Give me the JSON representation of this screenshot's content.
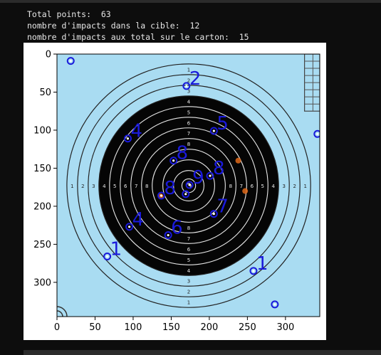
{
  "output": {
    "line1": "Total points:  63",
    "line2": "nombre d'impacts dans la cible:  12",
    "line3": "nombre d'impacts aux total sur le carton:  15"
  },
  "colors": {
    "background": "#0d0d0d",
    "text": "#e6e6e6",
    "card": "#a9dcf2",
    "annotation": "#1a1adb",
    "black_zone": "#050505"
  },
  "target": {
    "ring_numbers": [
      "1",
      "2",
      "3",
      "4",
      "5",
      "6",
      "7",
      "8"
    ]
  },
  "chart_data": {
    "type": "scatter",
    "title": "",
    "xlabel": "",
    "ylabel": "",
    "xlim": [
      0,
      345
    ],
    "ylim": [
      345,
      0
    ],
    "x_ticks": [
      0,
      50,
      100,
      150,
      200,
      250,
      300
    ],
    "y_ticks": [
      0,
      50,
      100,
      150,
      200,
      250,
      300
    ],
    "impacts": [
      {
        "x": 18,
        "y": 9,
        "label": ""
      },
      {
        "x": 170,
        "y": 42,
        "label": "2"
      },
      {
        "x": 206,
        "y": 101,
        "label": "5"
      },
      {
        "x": 93,
        "y": 111,
        "label": "4"
      },
      {
        "x": 342,
        "y": 105,
        "label": ""
      },
      {
        "x": 153,
        "y": 140,
        "label": "8"
      },
      {
        "x": 201,
        "y": 160,
        "label": "8"
      },
      {
        "x": 174,
        "y": 172,
        "label": "9"
      },
      {
        "x": 169,
        "y": 184,
        "label": ""
      },
      {
        "x": 137,
        "y": 186,
        "label": "8"
      },
      {
        "x": 206,
        "y": 210,
        "label": "7"
      },
      {
        "x": 95,
        "y": 227,
        "label": "4"
      },
      {
        "x": 146,
        "y": 238,
        "label": "6"
      },
      {
        "x": 66,
        "y": 266,
        "label": "1"
      },
      {
        "x": 258,
        "y": 285,
        "label": "1"
      },
      {
        "x": 286,
        "y": 329,
        "label": ""
      }
    ],
    "orange_marks": [
      {
        "x": 238,
        "y": 140
      },
      {
        "x": 247,
        "y": 180
      },
      {
        "x": 136,
        "y": 187
      }
    ]
  }
}
